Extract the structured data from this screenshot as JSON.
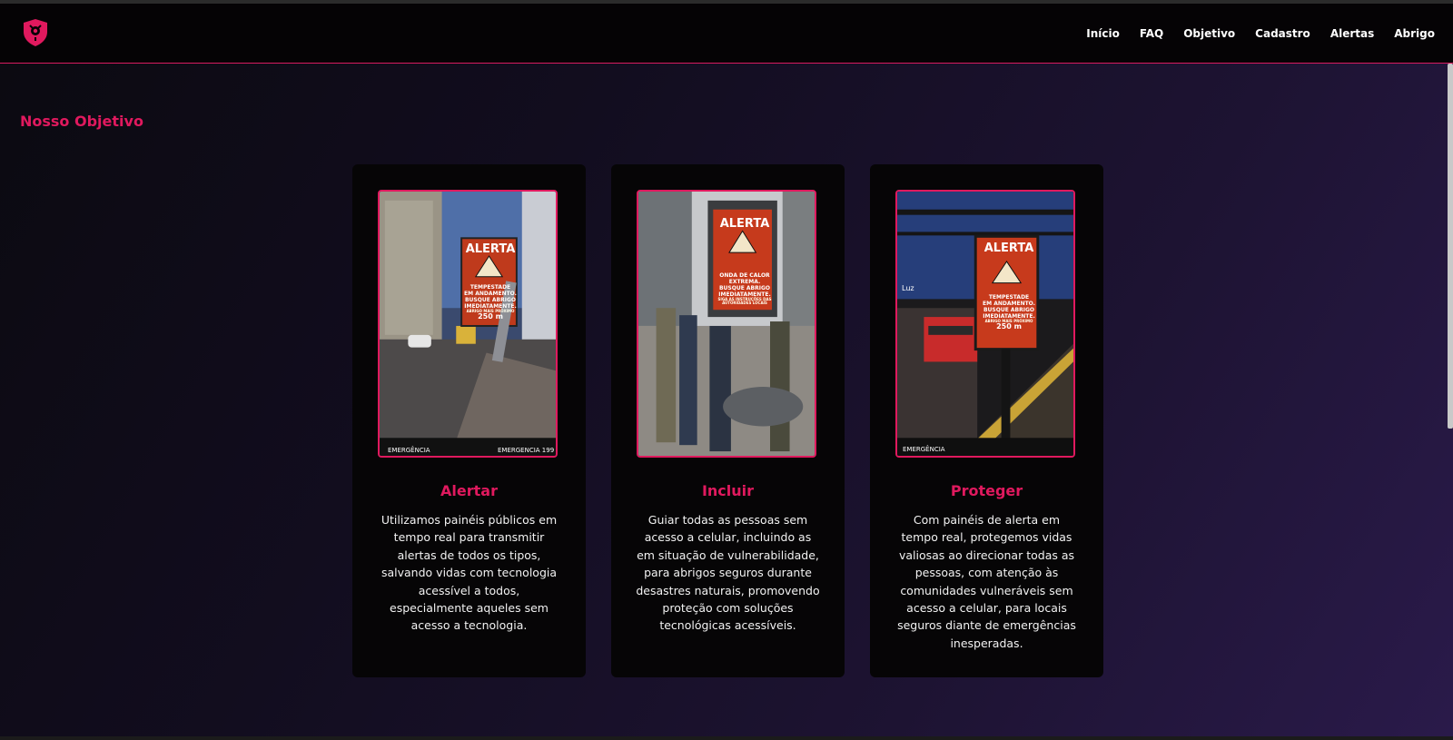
{
  "header": {
    "logo_icon": "shield-alert-icon",
    "nav": [
      "Início",
      "FAQ",
      "Objetivo",
      "Cadastro",
      "Alertas",
      "Abrigo"
    ]
  },
  "section": {
    "title": "Nosso Objetivo"
  },
  "cards": [
    {
      "title": "Alertar",
      "text": "Utilizamos painéis públicos em tempo real para transmitir alertas de todos os tipos, salvando vidas com tecnologia acessível a todos, especialmente aqueles sem acesso a tecnologia.",
      "image": {
        "sign_title": "ALERTA",
        "sign_lines": [
          "TEMPESTADE",
          "EM ANDAMENTO.",
          "BUSQUE ABRIGO",
          "IMEDIATAMENTE."
        ],
        "sign_small": "ABRIGO MAIS PRÓXIMO",
        "sign_distance": "250 m",
        "footer_left": "EMERGÊNCIA",
        "footer_right": "EMERGENCIA 199"
      }
    },
    {
      "title": "Incluir",
      "text": "Guiar todas as pessoas sem acesso a celular, incluindo as em situação de vulnerabilidade, para abrigos seguros durante desastres naturais, promovendo proteção com soluções tecnológicas acessíveis.",
      "image": {
        "sign_title": "ALERTA",
        "sign_lines": [
          "ONDA DE CALOR",
          "EXTREMA.",
          "BUSQUE ABRIGO",
          "IMEDIATAMENTE."
        ],
        "sign_small": "SIGA AS INSTRUÇÕES DAS AUTORIDADES LOCAIS"
      }
    },
    {
      "title": "Proteger",
      "text": "Com painéis de alerta em tempo real, protegemos vidas valiosas ao direcionar todas as pessoas, com atenção às comunidades vulneráveis sem acesso a celular, para locais seguros diante de emergências inesperadas.",
      "image": {
        "sign_title": "ALERTA",
        "sign_lines": [
          "TEMPESTADE",
          "EM ANDAMENTO.",
          "BUSQUE ABRIGO",
          "IMEDIATAMENTE."
        ],
        "sign_small": "ABRIGO MAIS PRÓXIMO",
        "sign_distance": "250 m",
        "station_label": "Luz",
        "footer_left": "EMERGÊNCIA"
      }
    }
  ],
  "colors": {
    "accent": "#e0195e",
    "header_bg": "#050305",
    "card_bg": "#060506"
  }
}
